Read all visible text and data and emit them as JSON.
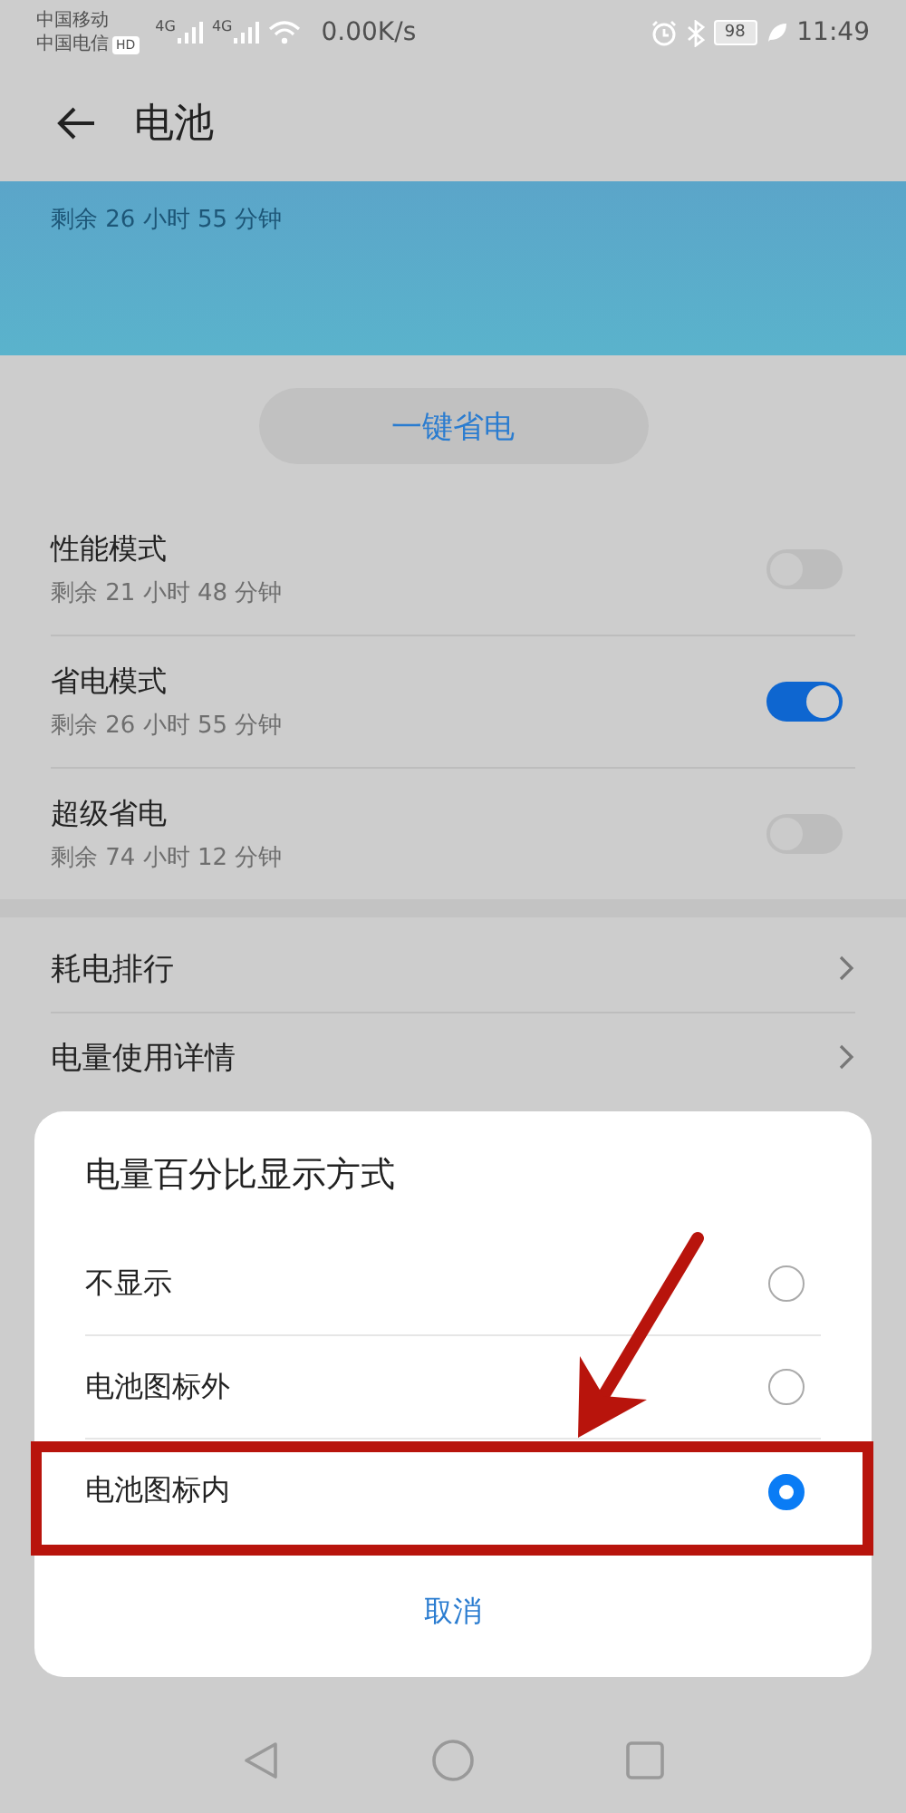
{
  "status_bar": {
    "carriers": [
      "中国移动",
      "中国电信"
    ],
    "hd_badge": "HD",
    "network_badges": [
      "4G",
      "4G"
    ],
    "speed": "0.00K/s",
    "battery": "98",
    "time": "11:49"
  },
  "header": {
    "title": "电池"
  },
  "banner": {
    "remaining": "剩余 26 小时 55 分钟"
  },
  "save_button": "一键省电",
  "modes": [
    {
      "title": "性能模式",
      "subtitle": "剩余 21 小时 48 分钟",
      "on": false
    },
    {
      "title": "省电模式",
      "subtitle": "剩余 26 小时 55 分钟",
      "on": true
    },
    {
      "title": "超级省电",
      "subtitle": "剩余 74 小时 12 分钟",
      "on": false
    }
  ],
  "links": [
    {
      "label": "耗电排行"
    },
    {
      "label": "电量使用详情"
    }
  ],
  "dialog": {
    "title": "电量百分比显示方式",
    "options": [
      {
        "label": "不显示",
        "selected": false,
        "highlighted": false
      },
      {
        "label": "电池图标外",
        "selected": false,
        "highlighted": false
      },
      {
        "label": "电池图标内",
        "selected": true,
        "highlighted": true
      }
    ],
    "cancel": "取消"
  }
}
